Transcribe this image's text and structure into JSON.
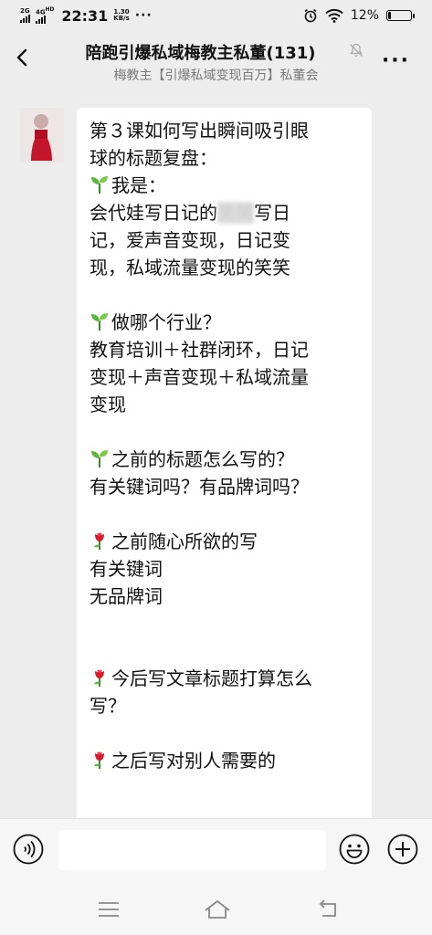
{
  "status_bar": {
    "network_1": "2G",
    "network_2": "4G",
    "network_2_suffix": "HD",
    "time": "22:31",
    "speed_value": "1.30",
    "speed_unit": "KB/s",
    "overflow": "···",
    "battery_text": "12%",
    "battery_level": 0.12
  },
  "header": {
    "title": "陪跑引爆私域梅教主私董(131)",
    "subtitle": "梅教主【引爆私域变现百万】私董会",
    "more": "···"
  },
  "message": {
    "lines": [
      {
        "text": "第３课如何写出瞬间吸引眼"
      },
      {
        "text": "球的标题复盘："
      },
      {
        "emoji": "seedling",
        "text": "我是："
      },
      {
        "text": "会代娃写日记的",
        "blur": "笑笑",
        "after": "写日"
      },
      {
        "text": "记，爱声音变现，日记变"
      },
      {
        "text": "现，私域流量变现的笑笑"
      },
      {
        "text": ""
      },
      {
        "emoji": "seedling",
        "text": "做哪个行业？"
      },
      {
        "text": "教育培训＋社群闭环，日记"
      },
      {
        "text": "变现＋声音变现＋私域流量"
      },
      {
        "text": "变现"
      },
      {
        "text": ""
      },
      {
        "emoji": "seedling",
        "text": "之前的标题怎么写的？"
      },
      {
        "text": "有关键词吗？有品牌词吗？"
      },
      {
        "text": ""
      },
      {
        "emoji": "rose",
        "text": "之前随心所欲的写"
      },
      {
        "text": "有关键词"
      },
      {
        "text": "无品牌词"
      },
      {
        "text": ""
      },
      {
        "text": ""
      },
      {
        "emoji": "rose",
        "text": "今后写文章标题打算怎么"
      },
      {
        "text": "写？"
      },
      {
        "text": ""
      },
      {
        "emoji": "rose",
        "text": "之后写对别人需要的"
      }
    ]
  },
  "colors": {
    "background": "#ededed",
    "bubble": "#ffffff",
    "input_bar": "#f6f6f6",
    "subtitle": "#7a7a7a"
  }
}
